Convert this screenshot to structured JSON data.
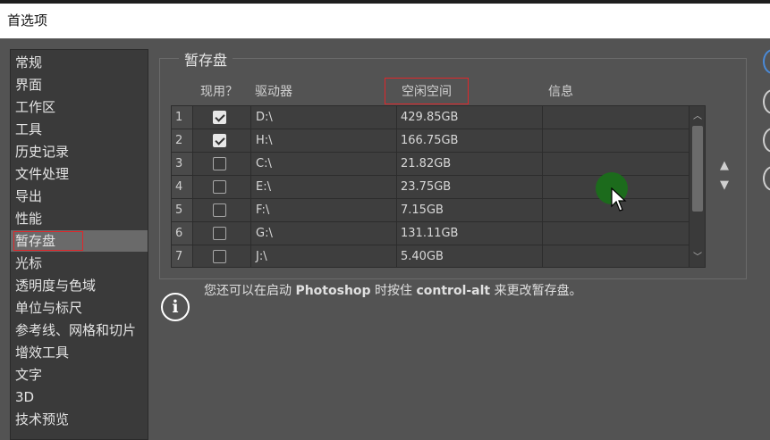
{
  "window": {
    "title": "首选项"
  },
  "sidebar": {
    "items": [
      {
        "label": "常规"
      },
      {
        "label": "界面"
      },
      {
        "label": "工作区"
      },
      {
        "label": "工具"
      },
      {
        "label": "历史记录"
      },
      {
        "label": "文件处理"
      },
      {
        "label": "导出"
      },
      {
        "label": "性能"
      },
      {
        "label": "暂存盘"
      },
      {
        "label": "光标"
      },
      {
        "label": "透明度与色域"
      },
      {
        "label": "单位与标尺"
      },
      {
        "label": "参考线、网格和切片"
      },
      {
        "label": "增效工具"
      },
      {
        "label": "文字"
      },
      {
        "label": "3D"
      },
      {
        "label": "技术预览"
      }
    ],
    "selected_index": 8
  },
  "scratch": {
    "title": "暂存盘",
    "headers": {
      "active": "现用？",
      "drive": "驱动器",
      "free": "空闲空间",
      "info": "信息"
    },
    "rows": [
      {
        "num": "1",
        "checked": true,
        "drive": "D:\\",
        "free": "429.85GB",
        "info": ""
      },
      {
        "num": "2",
        "checked": true,
        "drive": "H:\\",
        "free": "166.75GB",
        "info": ""
      },
      {
        "num": "3",
        "checked": false,
        "drive": "C:\\",
        "free": "21.82GB",
        "info": ""
      },
      {
        "num": "4",
        "checked": false,
        "drive": "E:\\",
        "free": "23.75GB",
        "info": ""
      },
      {
        "num": "5",
        "checked": false,
        "drive": "F:\\",
        "free": "7.15GB",
        "info": ""
      },
      {
        "num": "6",
        "checked": false,
        "drive": "G:\\",
        "free": "131.11GB",
        "info": ""
      },
      {
        "num": "7",
        "checked": false,
        "drive": "J:\\",
        "free": "5.40GB",
        "info": ""
      }
    ],
    "move_up": "▲",
    "move_down": "▼"
  },
  "note": {
    "prefix": "您还可以在启动 ",
    "app": "Photoshop",
    "middle": " 时按住 ",
    "keys": "control-alt",
    "suffix": " 来更改暂存盘。"
  },
  "icons": {
    "info": "info-circle-icon",
    "check": "checkmark-icon",
    "cursor": "mouse-pointer-icon"
  },
  "colors": {
    "highlight_box": "#e0262a",
    "radio_active": "#4a8ad8"
  }
}
